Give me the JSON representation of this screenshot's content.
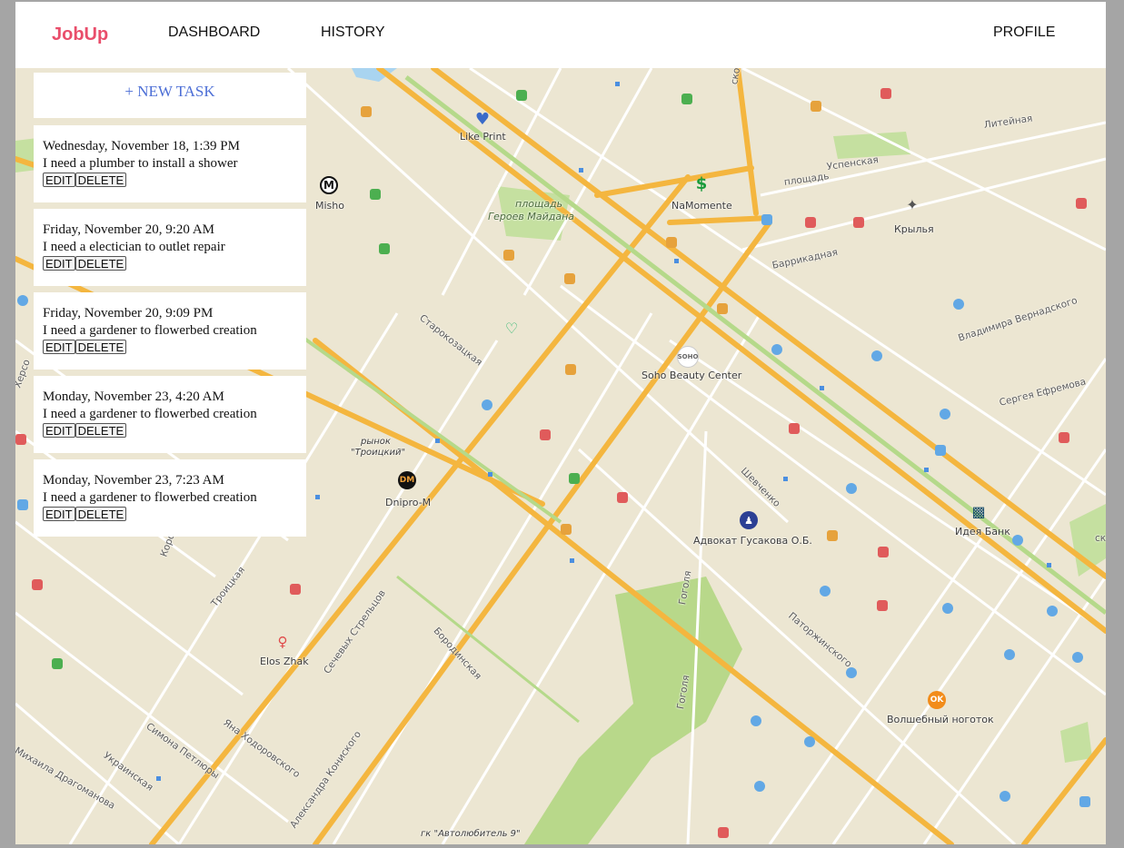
{
  "nav": {
    "brand": "JobUp",
    "dashboard": "DASHBOARD",
    "history": "HISTORY",
    "profile": "PROFILE"
  },
  "panel": {
    "new_task": "+ NEW TASK",
    "edit_label": "EDIT",
    "delete_label": "DELETE",
    "tasks": [
      {
        "date": "Wednesday, November 18, 1:39 PM",
        "desc": "I need a plumber to install a shower"
      },
      {
        "date": "Friday, November 20, 9:20 AM",
        "desc": "I need a electician to outlet repair"
      },
      {
        "date": "Friday, November 20, 9:09 PM",
        "desc": "I need a gardener to flowerbed creation"
      },
      {
        "date": "Monday, November 23, 4:20 AM",
        "desc": "I need a gardener to flowerbed creation"
      },
      {
        "date": "Monday, November 23, 7:23 AM",
        "desc": "I need a gardener to flowerbed creation"
      }
    ]
  },
  "map": {
    "places": {
      "like_print": "Like Print",
      "misho": "Misho",
      "namomente": "NaMomente",
      "krylya": "Крылья",
      "soho": "Soho Beauty Center",
      "soho_logo": "SOHO",
      "dnipro": "Dnipro-M",
      "advokat": "Адвокат Гусакова О.Б.",
      "ideya": "Идея Банк",
      "elos": "Elos Zhak",
      "nogotok": "Волшебный ноготок",
      "ploshad": "площадь",
      "heroes": "Героев Майдана",
      "rynok": "рынок",
      "troitskiy": "\"Троицкий\"",
      "avtolyubitel": "гк \"Автолюбитель 9\""
    },
    "streets": {
      "liteynaya": "Литейная",
      "uspenskaya": "Успенская",
      "ploshad2": "площадь",
      "barrikadnaya": "Баррикадная",
      "vernadskogo": "Владимира Вернадского",
      "efremova": "Сергея Ефремова",
      "starokazatskaya": "Старокозацкая",
      "shevchenko": "Шевченко",
      "troitskaya": "Троицкая",
      "sechevyh": "Сечевых Стрельцов",
      "borodinskaya": "Бородинская",
      "gogolya1": "Гоголя",
      "gogolya2": "Гоголя",
      "patorzhinskogo": "Паторжинского",
      "petlyury": "Симона Петлюры",
      "hodorovskogo": "Яна Ходоровского",
      "ukrainskaya": "Украинская",
      "dragomanova": "Михаила Драгоманова",
      "konisskogo": "Александра Кониского",
      "khersonskaya": "Херсо",
      "korolenko": "Короле",
      "novo": "ского",
      "sko": "ско"
    }
  }
}
